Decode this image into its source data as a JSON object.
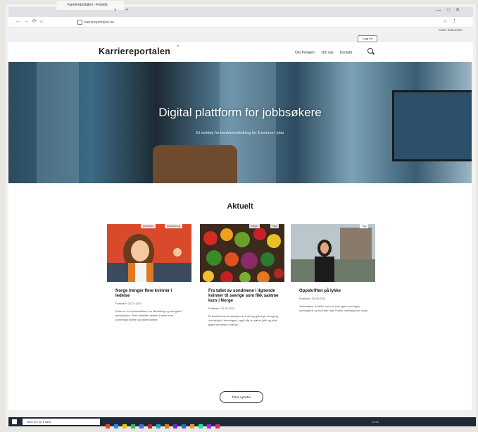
{
  "browser": {
    "tab_title": "Karriereportalen - Forside",
    "url": "karriereportalen.no",
    "bookmarks_label": "Andre bokmerker"
  },
  "site": {
    "login_label": "Logg inn",
    "logo": "Karriereportalen",
    "nav": [
      "Om Portalen",
      "Om oss",
      "Kontakt"
    ],
    "hero_title": "Digital plattform for jobbsøkere",
    "hero_subtitle": "Et verktøy for karriereveiledning for å komme i jobb",
    "section_title": "Aktuelt",
    "more_button": "Flere nyheter"
  },
  "cards": [
    {
      "tags": [
        "Arbeidsliv",
        "Rekruttering"
      ],
      "title": "Norge trenger flere kvinner i ledelse",
      "date": "Publisert: 21.01.2021",
      "text": "Dette er en nyhetsartikkel om likestilling og mangfold i arbeidslivet. Flere bedrifter ønsker å løfte frem kvinnelige ledere og rollemodeller."
    },
    {
      "tags": [
        "Helse",
        "Tips"
      ],
      "title": "Fra tallet av sondmene i lignende kvinner til sverige som fikk samme kurs i Norge",
      "date": "Publisert: 10.02.2021",
      "text": "Et kosthold med variasjon av frukt og grønt gir energi og overskudd i hverdagen, også når du søker jobb og skal gjøre ditt beste i intervju."
    },
    {
      "tags": [
        "Tips"
      ],
      "title": "Oppskriften på lykke",
      "date": "Publisert: 03.03.2021",
      "text": "Jobbsøkere forteller om hva som gjør hverdagen meningsfull og hvordan man holder motivasjonen oppe."
    }
  ],
  "taskbar": {
    "search_placeholder": "Skriv her for å søke",
    "time": "13:42"
  }
}
